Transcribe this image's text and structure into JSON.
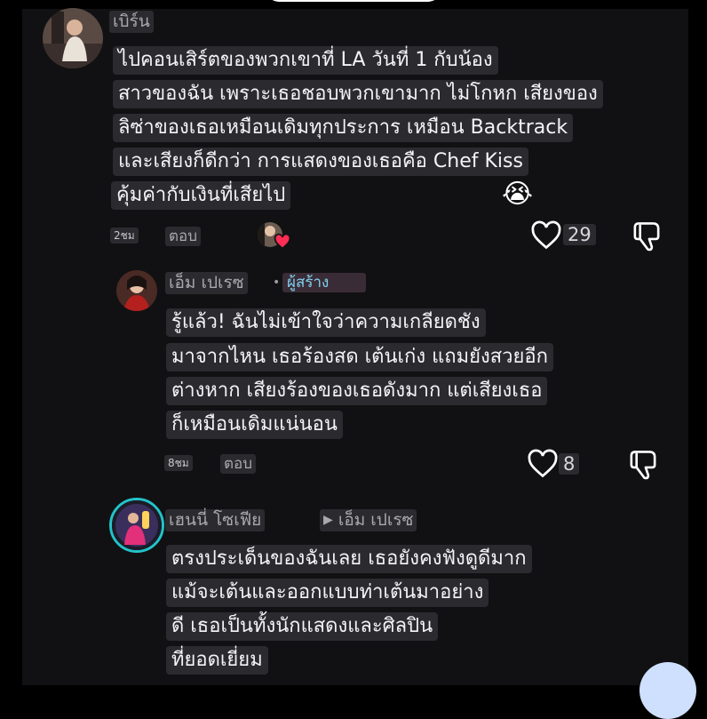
{
  "comment1": {
    "username": "เบิร์น",
    "lines": [
      "ไปคอนเสิร์ตของพวกเขาที่ LA วันที่ 1 กับน้อง",
      "สาวของฉัน เพราะเธอชอบพวกเขามาก ไม่โกหก เสียงของ",
      "ลิซ่าของเธอเหมือนเดิมทุกประการ เหมือน Backtrack",
      "และเสียงก็ดีกว่า การแสดงของเธอคือ Chef Kiss",
      "คุ้มค่ากับเงินที่เสียไป"
    ],
    "emoji": "😭",
    "time": "2ชม",
    "reply_label": "ตอบ",
    "likes": "29"
  },
  "comment2": {
    "username": "เอ็ม เปเรซ",
    "bullet": "•",
    "creator_badge": "ผู้สร้าง",
    "lines": [
      "รู้แล้ว! ฉันไม่เข้าใจว่าความเกลียดชัง",
      "มาจากไหน เธอร้องสด เต้นเก่ง แถมยังสวยอีก",
      "ต่างหาก เสียงร้องของเธอดังมาก แต่เสียงเธอ",
      "ก็เหมือนเดิมแน่นอน"
    ],
    "time": "8ชม",
    "reply_label": "ตอบ",
    "likes": "8"
  },
  "comment3": {
    "username": "เฮนนี่ โซเฟีย",
    "reply_to": "เอ็ม เปเรซ",
    "lines": [
      "ตรงประเด็นของฉันเลย เธอยังคงฟังดูดีมาก",
      "แม้จะเต้นและออกแบบท่าเต้นมาอย่าง",
      "ดี เธอเป็นทั้งนักแสดงและศิลปิน",
      "ที่ยอดเยี่ยม"
    ]
  },
  "colors": {
    "background": "#111113",
    "bubble": "#2b2b2f",
    "creator_text": "#7fd0f0",
    "heart_red": "#ff2d55",
    "story_ring": "#22c3c9"
  }
}
